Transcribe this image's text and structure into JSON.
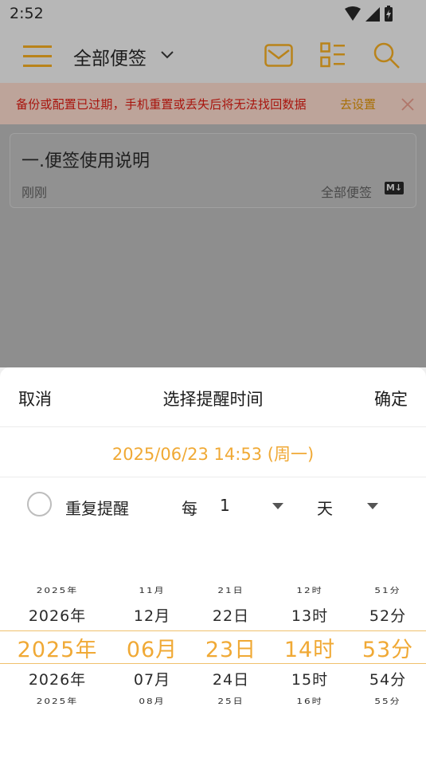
{
  "status_bar": {
    "time": "2:52"
  },
  "toolbar": {
    "title": "全部便签"
  },
  "banner": {
    "text": "备份或配置已过期，手机重置或丢失后将无法找回数据",
    "link": "去设置"
  },
  "note": {
    "title": "一.便签使用说明",
    "time": "刚刚",
    "folder": "全部便签",
    "badge": "M↓"
  },
  "sheet": {
    "cancel": "取消",
    "title": "选择提醒时间",
    "confirm": "确定",
    "selected_datetime": "2025/06/23 14:53 (周一)",
    "repeat_label": "重复提醒",
    "every_label": "每",
    "interval_value": "1",
    "unit_value": "天"
  },
  "picker": {
    "columns": [
      {
        "far_top": "2025年",
        "near_top": "2026年",
        "selected": "2025年",
        "near_bottom": "2026年",
        "far_bottom": "2025年"
      },
      {
        "far_top": "11月",
        "near_top": "12月",
        "selected": "06月",
        "near_bottom": "07月",
        "far_bottom": "08月"
      },
      {
        "far_top": "21日",
        "near_top": "22日",
        "selected": "23日",
        "near_bottom": "24日",
        "far_bottom": "25日"
      },
      {
        "far_top": "12时",
        "near_top": "13时",
        "selected": "14时",
        "near_bottom": "15时",
        "far_bottom": "16时"
      },
      {
        "far_top": "51分",
        "near_top": "52分",
        "selected": "53分",
        "near_bottom": "54分",
        "far_bottom": "55分"
      }
    ]
  },
  "colors": {
    "accent": "#f0a935",
    "warning_text": "#a8140d",
    "dim_overlay": "#8e8e8e"
  }
}
